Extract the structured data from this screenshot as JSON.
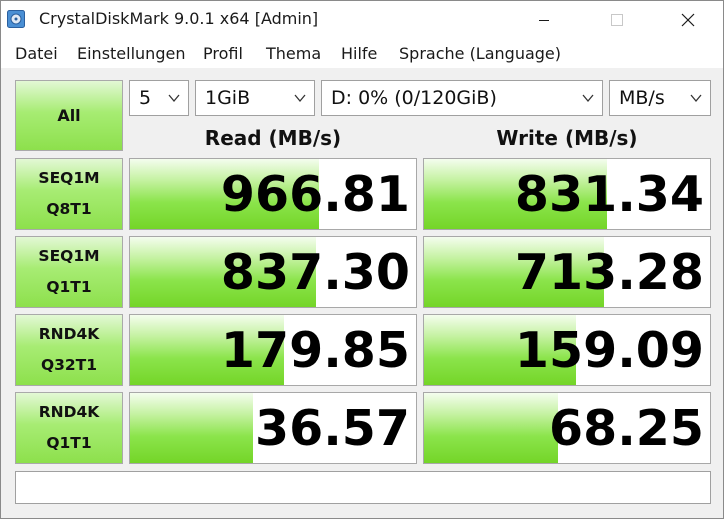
{
  "window": {
    "title": "CrystalDiskMark 9.0.1 x64 [Admin]"
  },
  "menu": [
    "Datei",
    "Einstellungen",
    "Profil",
    "Thema",
    "Hilfe",
    "Sprache (Language)"
  ],
  "controls": {
    "all_label": "All",
    "count": "5",
    "size": "1GiB",
    "drive": "D: 0% (0/120GiB)",
    "unit": "MB/s"
  },
  "headers": {
    "read": "Read (MB/s)",
    "write": "Write (MB/s)"
  },
  "tests": [
    {
      "line1": "SEQ1M",
      "line2": "Q8T1",
      "read": "966.81",
      "write": "831.34",
      "read_fill": 0.66,
      "write_fill": 0.64
    },
    {
      "line1": "SEQ1M",
      "line2": "Q1T1",
      "read": "837.30",
      "write": "713.28",
      "read_fill": 0.65,
      "write_fill": 0.63
    },
    {
      "line1": "RND4K",
      "line2": "Q32T1",
      "read": "179.85",
      "write": "159.09",
      "read_fill": 0.54,
      "write_fill": 0.53
    },
    {
      "line1": "RND4K",
      "line2": "Q1T1",
      "read": "36.57",
      "write": "68.25",
      "read_fill": 0.43,
      "write_fill": 0.47
    }
  ],
  "comment": ""
}
